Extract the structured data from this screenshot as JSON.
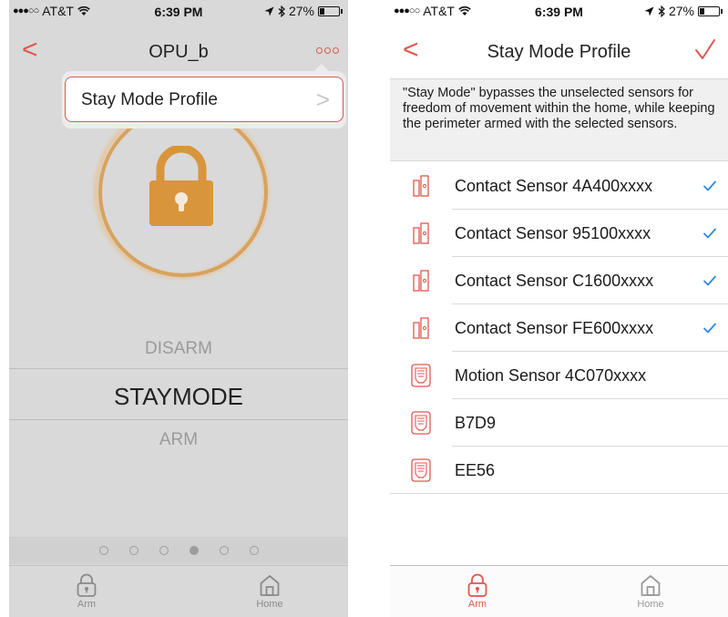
{
  "status": {
    "carrier": "AT&T",
    "time": "6:39 PM",
    "battery": "27%",
    "battery_level": 0.27
  },
  "left_screen": {
    "nav": {
      "title": "OPU_b"
    },
    "popover": {
      "item_label": "Stay Mode Profile"
    },
    "mode_picker": {
      "options": [
        "DISARM",
        "STAYMODE",
        "ARM"
      ],
      "selected": "STAYMODE"
    },
    "page_dots": {
      "count": 6,
      "active_index": 3
    },
    "tabs": [
      {
        "label": "Arm",
        "icon": "lock-icon"
      },
      {
        "label": "Home",
        "icon": "home-icon"
      }
    ]
  },
  "right_screen": {
    "nav": {
      "title": "Stay Mode Profile"
    },
    "description": "\"Stay Mode\" bypasses the unselected sensors for freedom of movement within the home, while keeping the perimeter armed with the selected sensors.",
    "sensors": [
      {
        "name": "Contact Sensor 4A400xxxx",
        "type": "contact",
        "selected": true
      },
      {
        "name": "Contact Sensor 95100xxxx",
        "type": "contact",
        "selected": true
      },
      {
        "name": "Contact Sensor C1600xxxx",
        "type": "contact",
        "selected": true
      },
      {
        "name": "Contact Sensor FE600xxxx",
        "type": "contact",
        "selected": true
      },
      {
        "name": "Motion Sensor 4C070xxxx",
        "type": "motion",
        "selected": false
      },
      {
        "name": "B7D9",
        "type": "motion",
        "selected": false
      },
      {
        "name": "EE56",
        "type": "motion",
        "selected": false
      }
    ],
    "tabs": [
      {
        "label": "Arm",
        "icon": "lock-icon",
        "active": true
      },
      {
        "label": "Home",
        "icon": "home-icon",
        "active": false
      }
    ]
  },
  "colors": {
    "accent": "#e0564f",
    "lock_gold": "#d9953c",
    "check_blue": "#2a8be0",
    "inactive": "#999999"
  }
}
